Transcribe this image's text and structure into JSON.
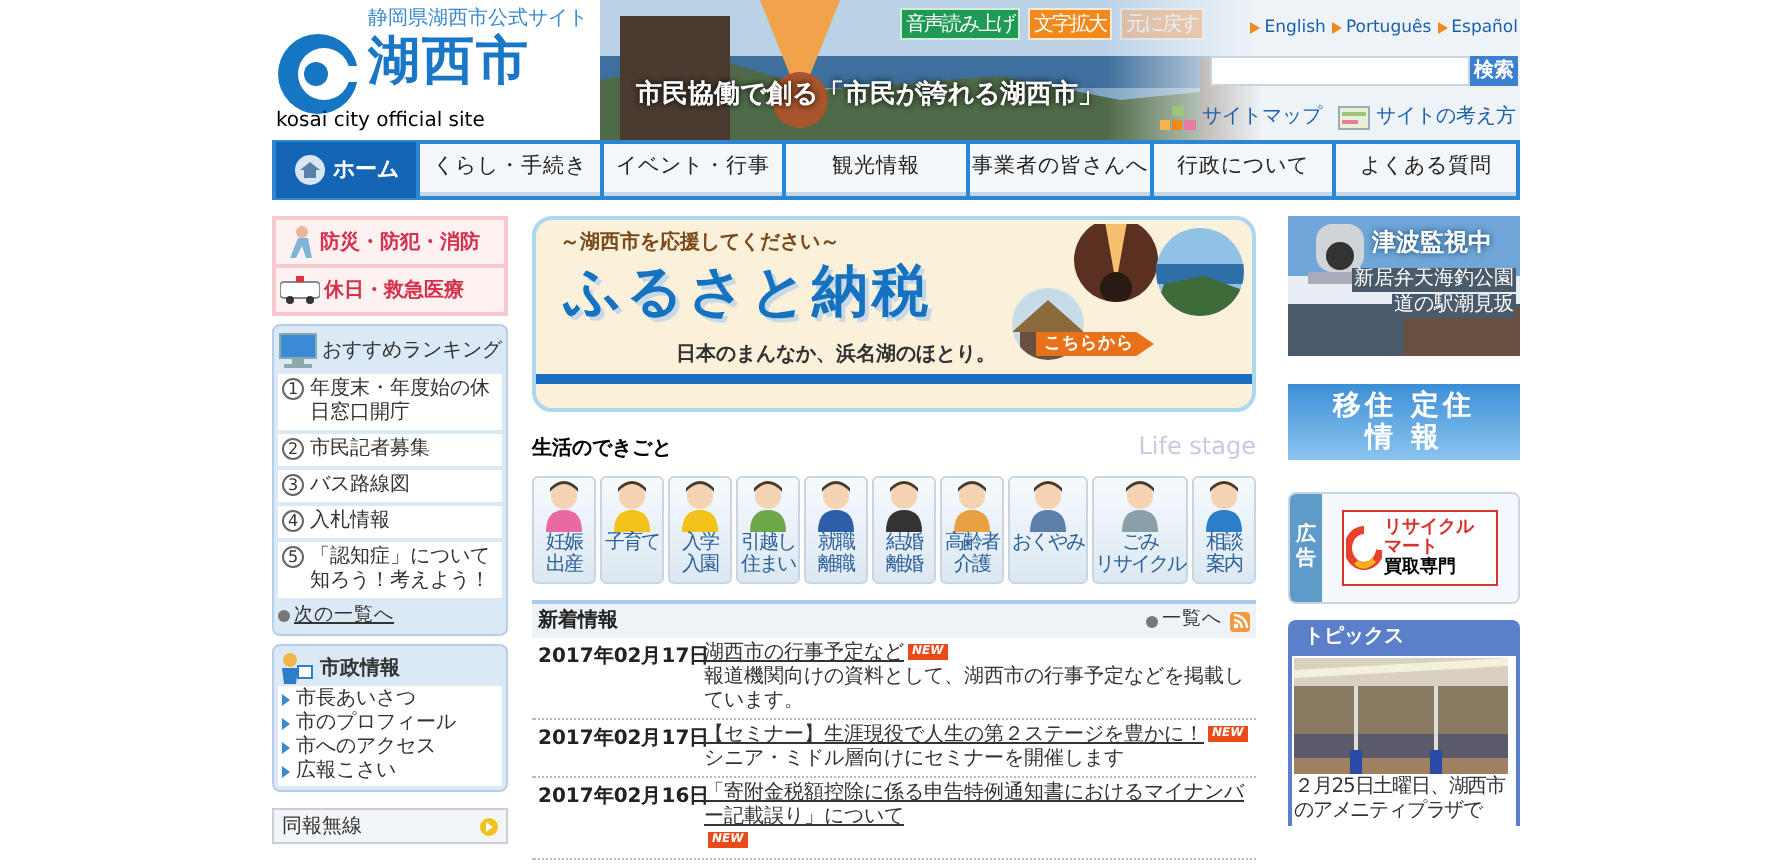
{
  "header": {
    "prefecture_label": "静岡県湖西市公式サイト",
    "city_name": "湖西市",
    "site_label": "kosai city official site",
    "slogan": "市民協働で創る「市民が誇れる湖西市」",
    "tools": [
      {
        "label": "音声読み上げ",
        "kind": "speech",
        "disabled": false
      },
      {
        "label": "文字拡大",
        "kind": "enlarge",
        "disabled": false
      },
      {
        "label": "元に戻す",
        "kind": "reset",
        "disabled": true
      }
    ],
    "languages": [
      "English",
      "Português",
      "Español"
    ],
    "search_button": "検索",
    "links": [
      "サイトマップ",
      "サイトの考え方"
    ]
  },
  "nav": [
    {
      "label": "ホーム",
      "selected": true
    },
    {
      "label": "くらし・手続き",
      "selected": false
    },
    {
      "label": "イベント・行事",
      "selected": false
    },
    {
      "label": "観光情報",
      "selected": false
    },
    {
      "label": "事業者の皆さんへ",
      "selected": false
    },
    {
      "label": "行政について",
      "selected": false
    },
    {
      "label": "よくある質問",
      "selected": false
    }
  ],
  "left": {
    "emergency": [
      "防災・防犯・消防",
      "休日・救急医療"
    ],
    "ranking": {
      "title": "おすすめランキング",
      "items": [
        {
          "number": "1",
          "text": "年度末・年度始の休日窓口開庁"
        },
        {
          "number": "2",
          "text": "市民記者募集"
        },
        {
          "number": "3",
          "text": "バス路線図"
        },
        {
          "number": "4",
          "text": "入札情報"
        },
        {
          "number": "5",
          "text": "「認知症」について知ろう！考えよう！"
        }
      ],
      "more_link": "次の一覧へ"
    },
    "city_info": {
      "title": "市政情報",
      "links": [
        "市長あいさつ",
        "市のプロフィール",
        "市へのアクセス",
        "広報こさい"
      ]
    },
    "radio": "同報無線"
  },
  "furusato": {
    "tagline": "～湖西市を応援してください～",
    "title": "ふるさと納税",
    "subtitle": "日本のまんなか、浜名湖のほとり。",
    "button": "こちらから"
  },
  "life_stage": {
    "title": "生活のできごと",
    "subtitle": "Life stage",
    "items": [
      {
        "lines": [
          "妊娠",
          "出産"
        ]
      },
      {
        "lines": [
          "子育て"
        ]
      },
      {
        "lines": [
          "入学",
          "入園"
        ]
      },
      {
        "lines": [
          "引越し",
          "住まい"
        ]
      },
      {
        "lines": [
          "就職",
          "離職"
        ]
      },
      {
        "lines": [
          "結婚",
          "離婚"
        ]
      },
      {
        "lines": [
          "高齢者",
          "介護"
        ]
      },
      {
        "lines": [
          "おくやみ"
        ]
      },
      {
        "lines": [
          "ごみ",
          "リサイクル"
        ]
      },
      {
        "lines": [
          "相談",
          "案内"
        ]
      }
    ]
  },
  "news": {
    "title": "新着情報",
    "more_link": "一覧へ",
    "items": [
      {
        "date": "2017年02月17日",
        "title": "湖西市の行事予定など",
        "badge": "NEW",
        "description": "報道機関向けの資料として、湖西市の行事予定などを掲載しています。"
      },
      {
        "date": "2017年02月17日",
        "title": "【セミナー】生涯現役で人生の第２ステージを豊かに！",
        "badge": "NEW",
        "description": "シニア・ミドル層向けにセミナーを開催します"
      },
      {
        "date": "2017年02月16日",
        "title": "「寄附金税額控除に係る申告特例通知書におけるマイナンバー記載誤り」について",
        "badge": "NEW"
      }
    ]
  },
  "right": {
    "tsunami": {
      "title": "津波監視中",
      "places": [
        "新居弁天海釣公園",
        "道の駅潮見坂"
      ]
    },
    "migration": {
      "lines": [
        "移住 定住",
        "情 報"
      ]
    },
    "ad": {
      "label": "広告",
      "sponsor": [
        "リサイクル",
        "マート"
      ],
      "tagline": "買取専門"
    },
    "topics": {
      "title": "トピックス",
      "caption": "２月25日土曜日、湖西市のアメニティプラザで"
    }
  }
}
